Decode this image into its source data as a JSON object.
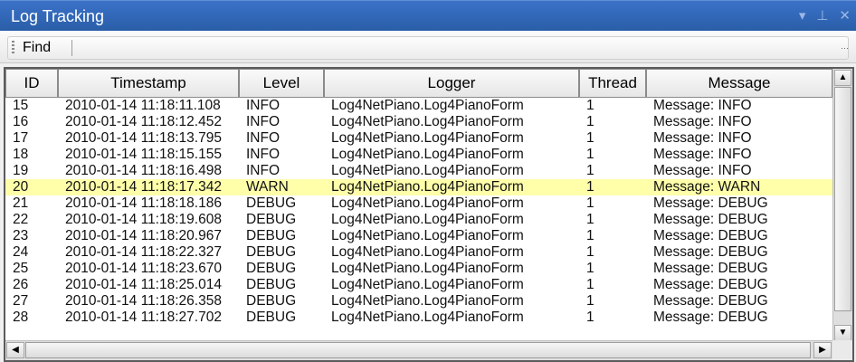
{
  "window": {
    "title": "Log Tracking",
    "icons": [
      "dropdown-arrow-icon",
      "pin-icon",
      "close-icon"
    ]
  },
  "toolbar": {
    "find_label": "Find"
  },
  "grid": {
    "columns": [
      "ID",
      "Timestamp",
      "Level",
      "Logger",
      "Thread",
      "Message"
    ],
    "highlight_color": "#ffffaa",
    "rows": [
      {
        "id": "15",
        "timestamp": "2010-01-14 11:18:11.108",
        "level": "INFO",
        "logger": "Log4NetPiano.Log4PianoForm",
        "thread": "1",
        "message": "Message: INFO"
      },
      {
        "id": "16",
        "timestamp": "2010-01-14 11:18:12.452",
        "level": "INFO",
        "logger": "Log4NetPiano.Log4PianoForm",
        "thread": "1",
        "message": "Message: INFO"
      },
      {
        "id": "17",
        "timestamp": "2010-01-14 11:18:13.795",
        "level": "INFO",
        "logger": "Log4NetPiano.Log4PianoForm",
        "thread": "1",
        "message": "Message: INFO"
      },
      {
        "id": "18",
        "timestamp": "2010-01-14 11:18:15.155",
        "level": "INFO",
        "logger": "Log4NetPiano.Log4PianoForm",
        "thread": "1",
        "message": "Message: INFO"
      },
      {
        "id": "19",
        "timestamp": "2010-01-14 11:18:16.498",
        "level": "INFO",
        "logger": "Log4NetPiano.Log4PianoForm",
        "thread": "1",
        "message": "Message: INFO"
      },
      {
        "id": "20",
        "timestamp": "2010-01-14 11:18:17.342",
        "level": "WARN",
        "logger": "Log4NetPiano.Log4PianoForm",
        "thread": "1",
        "message": "Message: WARN",
        "highlight": true
      },
      {
        "id": "21",
        "timestamp": "2010-01-14 11:18:18.186",
        "level": "DEBUG",
        "logger": "Log4NetPiano.Log4PianoForm",
        "thread": "1",
        "message": "Message: DEBUG"
      },
      {
        "id": "22",
        "timestamp": "2010-01-14 11:18:19.608",
        "level": "DEBUG",
        "logger": "Log4NetPiano.Log4PianoForm",
        "thread": "1",
        "message": "Message: DEBUG"
      },
      {
        "id": "23",
        "timestamp": "2010-01-14 11:18:20.967",
        "level": "DEBUG",
        "logger": "Log4NetPiano.Log4PianoForm",
        "thread": "1",
        "message": "Message: DEBUG"
      },
      {
        "id": "24",
        "timestamp": "2010-01-14 11:18:22.327",
        "level": "DEBUG",
        "logger": "Log4NetPiano.Log4PianoForm",
        "thread": "1",
        "message": "Message: DEBUG"
      },
      {
        "id": "25",
        "timestamp": "2010-01-14 11:18:23.670",
        "level": "DEBUG",
        "logger": "Log4NetPiano.Log4PianoForm",
        "thread": "1",
        "message": "Message: DEBUG"
      },
      {
        "id": "26",
        "timestamp": "2010-01-14 11:18:25.014",
        "level": "DEBUG",
        "logger": "Log4NetPiano.Log4PianoForm",
        "thread": "1",
        "message": "Message: DEBUG"
      },
      {
        "id": "27",
        "timestamp": "2010-01-14 11:18:26.358",
        "level": "DEBUG",
        "logger": "Log4NetPiano.Log4PianoForm",
        "thread": "1",
        "message": "Message: DEBUG"
      },
      {
        "id": "28",
        "timestamp": "2010-01-14 11:18:27.702",
        "level": "DEBUG",
        "logger": "Log4NetPiano.Log4PianoForm",
        "thread": "1",
        "message": "Message: DEBUG"
      }
    ]
  }
}
